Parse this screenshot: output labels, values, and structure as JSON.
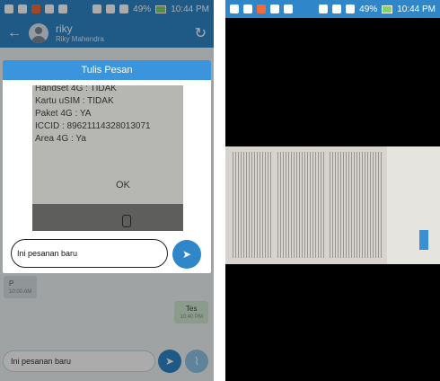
{
  "status_bar": {
    "battery": "49%",
    "time": "10:44 PM"
  },
  "app_bar": {
    "name": "riky",
    "subtitle": "Riky Mahendra"
  },
  "dialog": {
    "title": "Tulis Pesan",
    "photo_lines": [
      "Handset 4G : TIDAK",
      "Kartu uSIM : TIDAK",
      "Paket 4G : YA",
      "ICCID : 89621114328013071",
      "Area 4G : Ya"
    ],
    "photo_ok": "OK",
    "input_value": "Ini pesanan baru"
  },
  "chat": {
    "incoming": {
      "text": "P",
      "time": "10:00 AM"
    },
    "outgoing": {
      "text": "Tes",
      "time": "10:40 PM"
    }
  },
  "bottom_input_value": "Ini pesanan baru"
}
